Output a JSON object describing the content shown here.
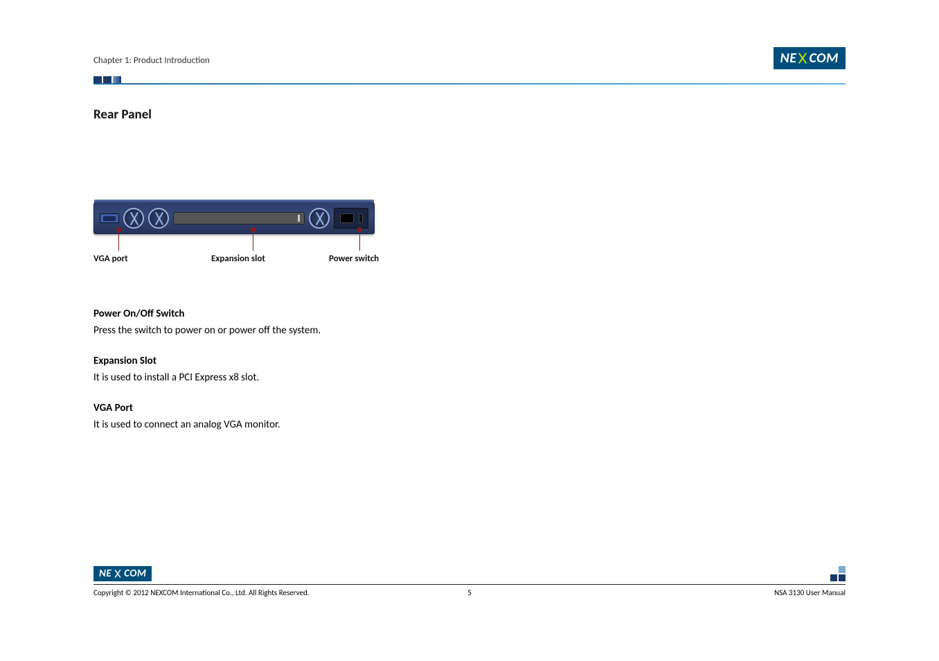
{
  "header": {
    "chapter": "Chapter 1: Product Introduction",
    "logo_text_1": "NE",
    "logo_text_2": "COM"
  },
  "section_title": "Rear Panel",
  "diagram": {
    "label_vga": "VGA port",
    "label_slot": "Expansion slot",
    "label_power": "Power switch"
  },
  "body": {
    "h1": "Power On/Off Switch",
    "p1": "Press the switch to power on or power off the system.",
    "h2": "Expansion Slot",
    "p2": "It is used to install a PCI Express x8 slot.",
    "h3": "VGA Port",
    "p3": "It is used to connect an analog VGA monitor."
  },
  "footer": {
    "copyright": "Copyright © 2012 NEXCOM International Co., Ltd. All Rights Reserved.",
    "page_number": "5",
    "doc_title": "NSA 3130 User Manual"
  }
}
